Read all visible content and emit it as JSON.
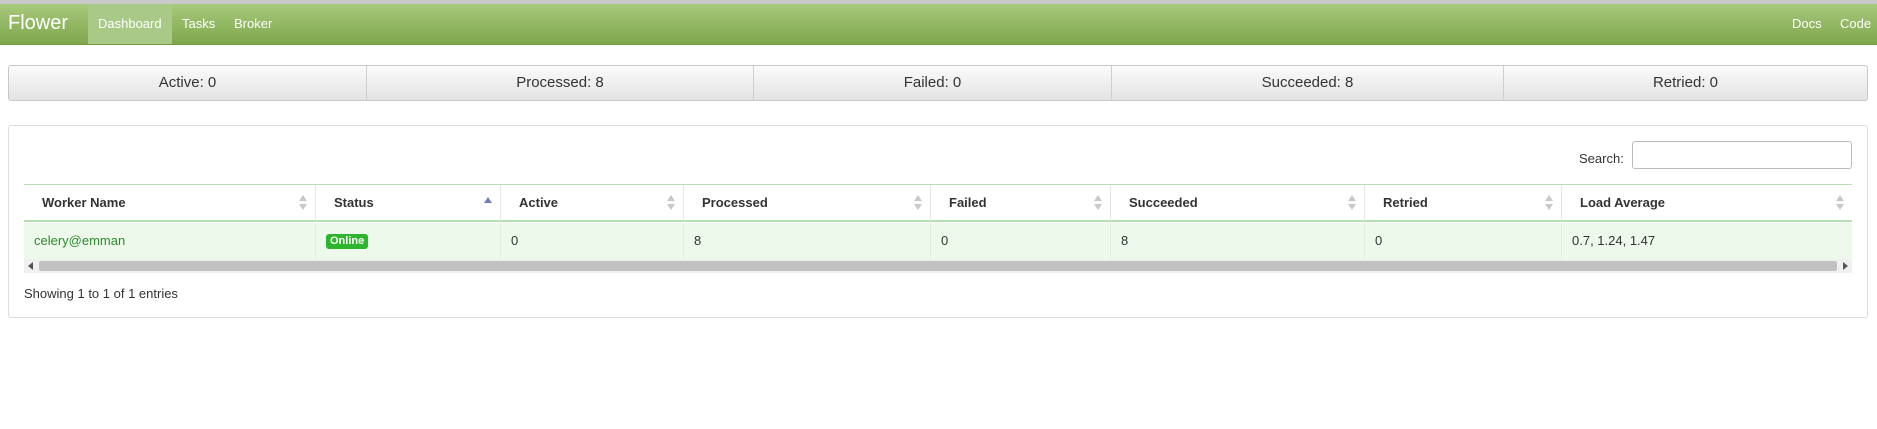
{
  "navbar": {
    "brand": "Flower",
    "items": [
      {
        "label": "Dashboard"
      },
      {
        "label": "Tasks"
      },
      {
        "label": "Broker"
      }
    ],
    "right_items": [
      {
        "label": "Docs"
      },
      {
        "label": "Code"
      }
    ]
  },
  "stats": [
    {
      "label": "Active: 0"
    },
    {
      "label": "Processed: 8"
    },
    {
      "label": "Failed: 0"
    },
    {
      "label": "Succeeded: 8"
    },
    {
      "label": "Retried: 0"
    }
  ],
  "search": {
    "label": "Search:",
    "value": ""
  },
  "table": {
    "columns": [
      "Worker Name",
      "Status",
      "Active",
      "Processed",
      "Failed",
      "Succeeded",
      "Retried",
      "Load Average"
    ],
    "sorted_column": "Status",
    "rows": [
      {
        "worker_name": "celery@emman",
        "status": "Online",
        "active": "0",
        "processed": "8",
        "failed": "0",
        "succeeded": "8",
        "retried": "0",
        "load_average": "0.7, 1.24, 1.47"
      }
    ]
  },
  "info": "Showing 1 to 1 of 1 entries",
  "colors": {
    "navbar": "#8db35d",
    "row_bg": "#ecf9eb",
    "status_online": "#2db52d",
    "link": "#2f8a2f"
  }
}
